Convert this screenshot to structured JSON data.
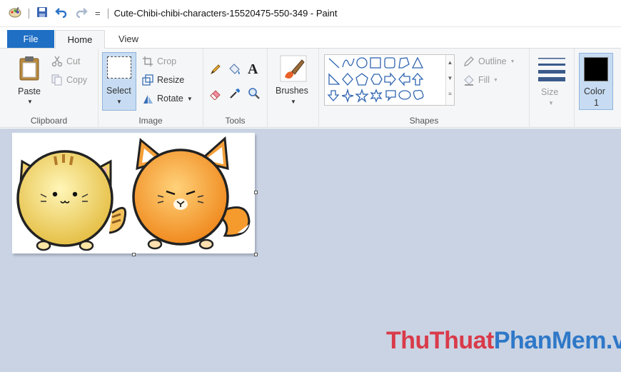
{
  "titlebar": {
    "title": "Cute-Chibi-chibi-characters-15520475-550-349 - Paint",
    "qa_dropdown": "="
  },
  "tabs": {
    "file": "File",
    "home": "Home",
    "view": "View"
  },
  "clipboard": {
    "paste": "Paste",
    "cut": "Cut",
    "copy": "Copy",
    "label": "Clipboard"
  },
  "image": {
    "select": "Select",
    "crop": "Crop",
    "resize": "Resize",
    "rotate": "Rotate",
    "label": "Image"
  },
  "tools": {
    "label": "Tools",
    "text_tool": "A"
  },
  "brushes": {
    "label": "Brushes"
  },
  "shapes": {
    "outline": "Outline",
    "fill": "Fill",
    "label": "Shapes"
  },
  "size": {
    "label": "Size"
  },
  "color": {
    "label": "Color",
    "number": "1",
    "current": "#000000"
  },
  "watermark": {
    "part1": "ThuThuat",
    "part2": "PhanMem.vn"
  }
}
